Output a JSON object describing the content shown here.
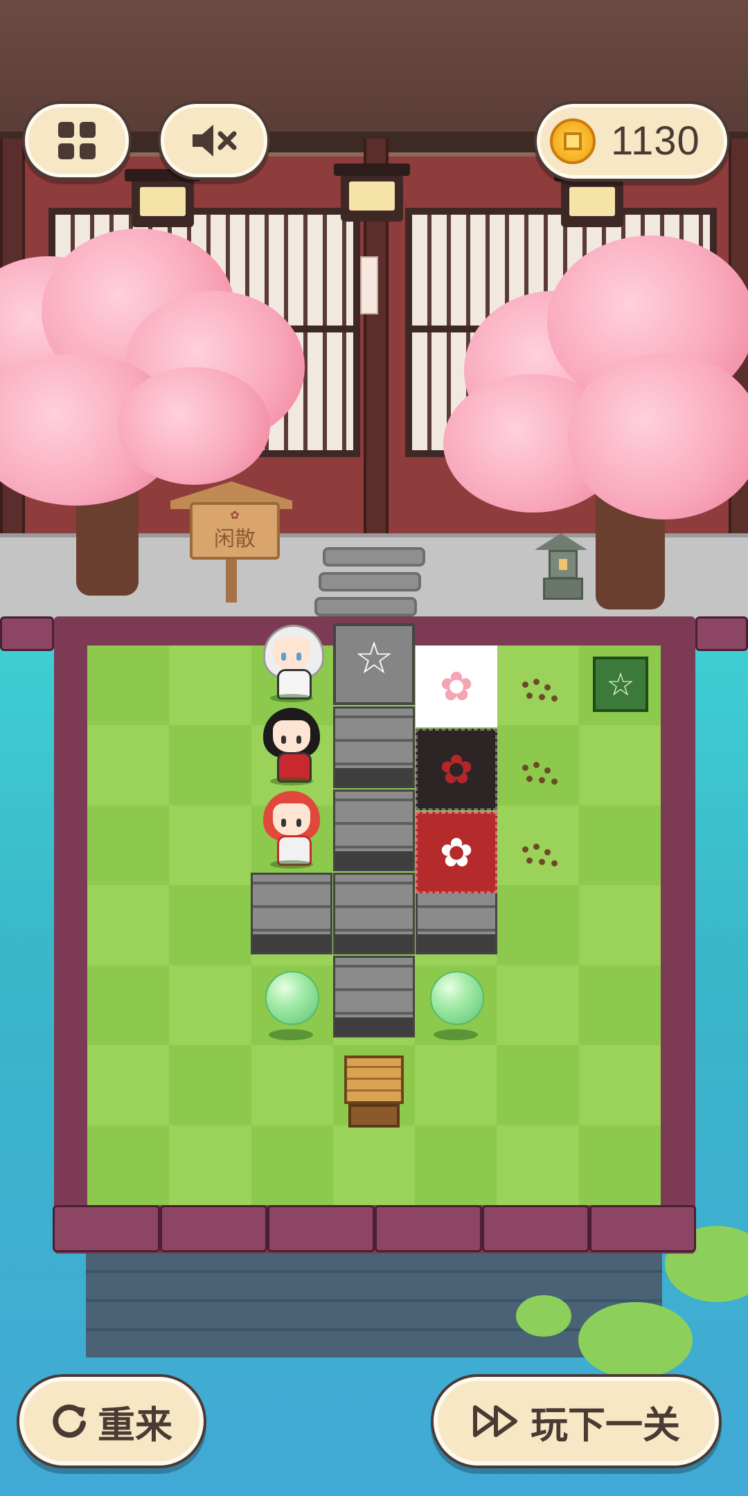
{
  "hud": {
    "menu_icon": "grid-menu-icon",
    "sound_icon": "speaker-muted-icon",
    "coin_icon": "coin-icon",
    "coins": "1130"
  },
  "scene": {
    "sign_text": "闲散"
  },
  "board": {
    "rows": 7,
    "cols": 7,
    "star_symbol": "☆",
    "carpet_symbol": "✿"
  },
  "buttons": {
    "retry_label": "重来",
    "next_label": "玩下一关",
    "retry_icon": "refresh-icon",
    "next_icon": "fast-forward-icon"
  },
  "colors": {
    "button_bg": "#f7e7c4",
    "button_outline": "#4a3a33",
    "grass_light": "#9bd25a",
    "grass_dark": "#8cc94c",
    "frame": "#8c4663"
  }
}
